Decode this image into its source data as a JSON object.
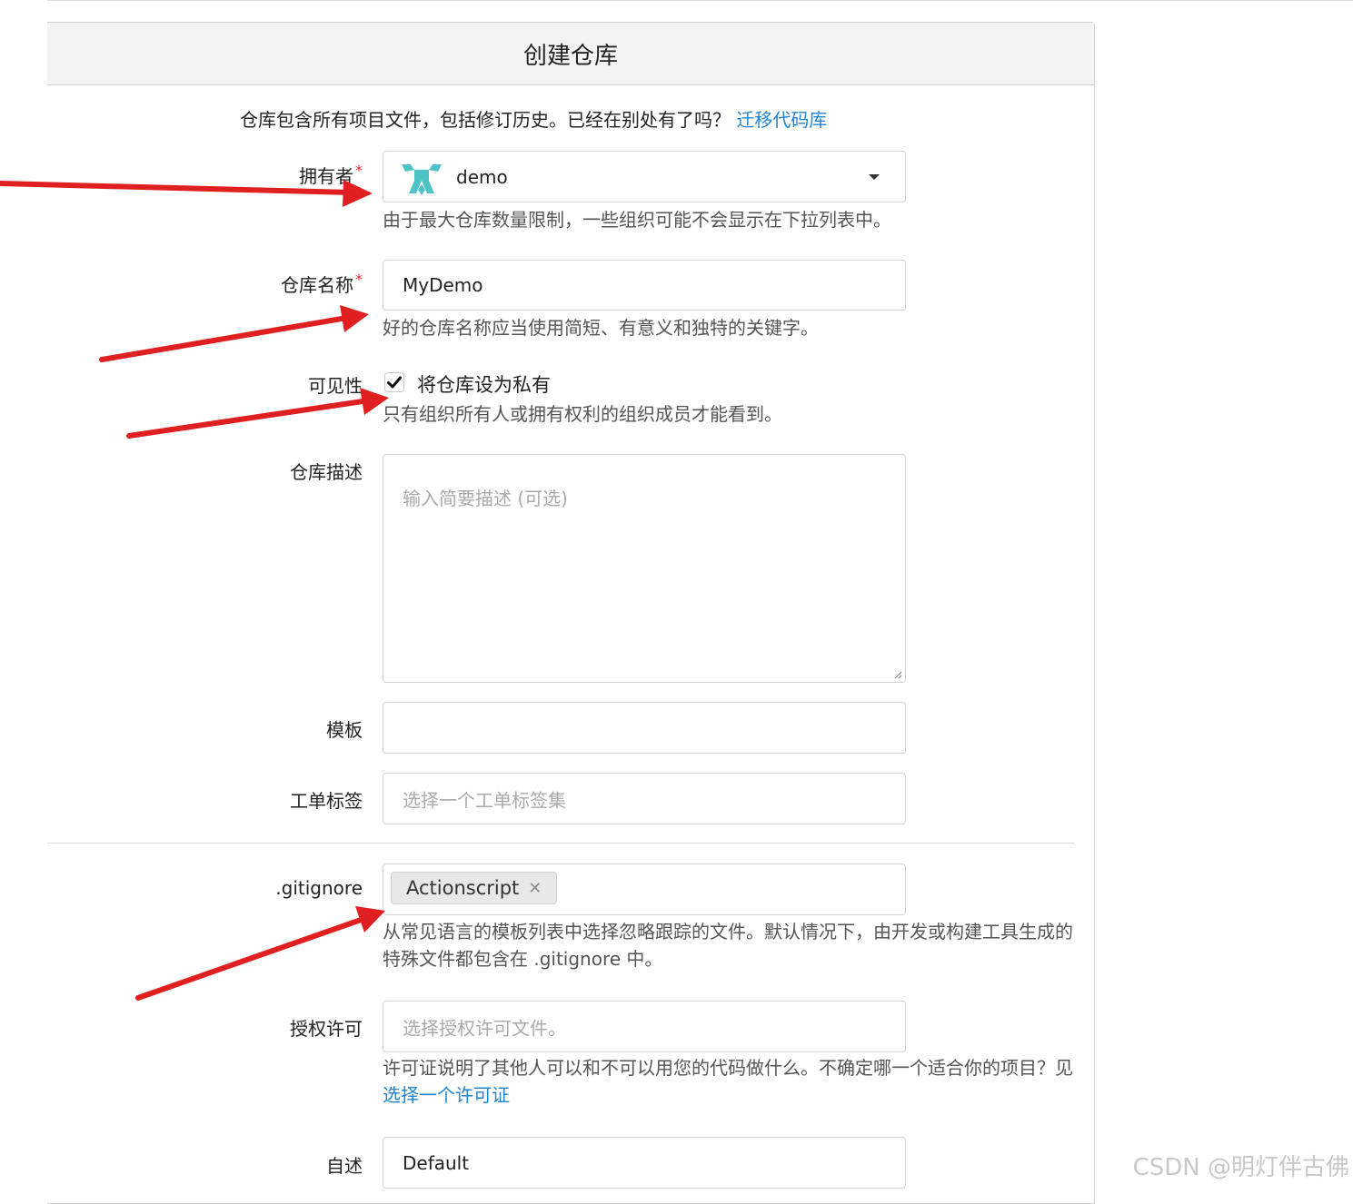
{
  "page": {
    "title": "创建仓库",
    "intro_text": "仓库包含所有项目文件，包括修订历史。已经在别处有了吗？",
    "intro_link": "迁移代码库"
  },
  "form": {
    "owner": {
      "label": "拥有者",
      "required_mark": "*",
      "value": "demo",
      "help": "由于最大仓库数量限制，一些组织可能不会显示在下拉列表中。"
    },
    "repo_name": {
      "label": "仓库名称",
      "required_mark": "*",
      "value": "MyDemo",
      "help": "好的仓库名称应当使用简短、有意义和独特的关键字。"
    },
    "visibility": {
      "label": "可见性",
      "checkbox_label": "将仓库设为私有",
      "checked": true,
      "help": "只有组织所有人或拥有权利的组织成员才能看到。"
    },
    "description": {
      "label": "仓库描述",
      "placeholder": "输入简要描述 (可选)"
    },
    "template": {
      "label": "模板",
      "value": ""
    },
    "issue_labels": {
      "label": "工单标签",
      "placeholder": "选择一个工单标签集"
    },
    "gitignore": {
      "label": ".gitignore",
      "tag": "Actionscript",
      "remove_glyph": "✕",
      "help": "从常见语言的模板列表中选择忽略跟踪的文件。默认情况下，由开发或构建工具生成的特殊文件都包含在 .gitignore 中。"
    },
    "license": {
      "label": "授权许可",
      "placeholder": "选择授权许可文件。",
      "help": "许可证说明了其他人可以和不可以用您的代码做什么。不确定哪一个适合你的项目？见",
      "help_link": "选择一个许可证"
    },
    "readme": {
      "label": "自述",
      "value": "Default"
    }
  },
  "watermark": "CSDN @明灯伴古佛",
  "colors": {
    "link": "#2185d0",
    "required": "#db2828",
    "annotation_arrow": "#e02020",
    "avatar": "#4fc3c8"
  },
  "icons": {
    "owner_avatar": "identicon-avatar",
    "dropdown": "caret-down-icon",
    "checkbox": "checkmark-icon",
    "tag_remove": "close-icon"
  }
}
